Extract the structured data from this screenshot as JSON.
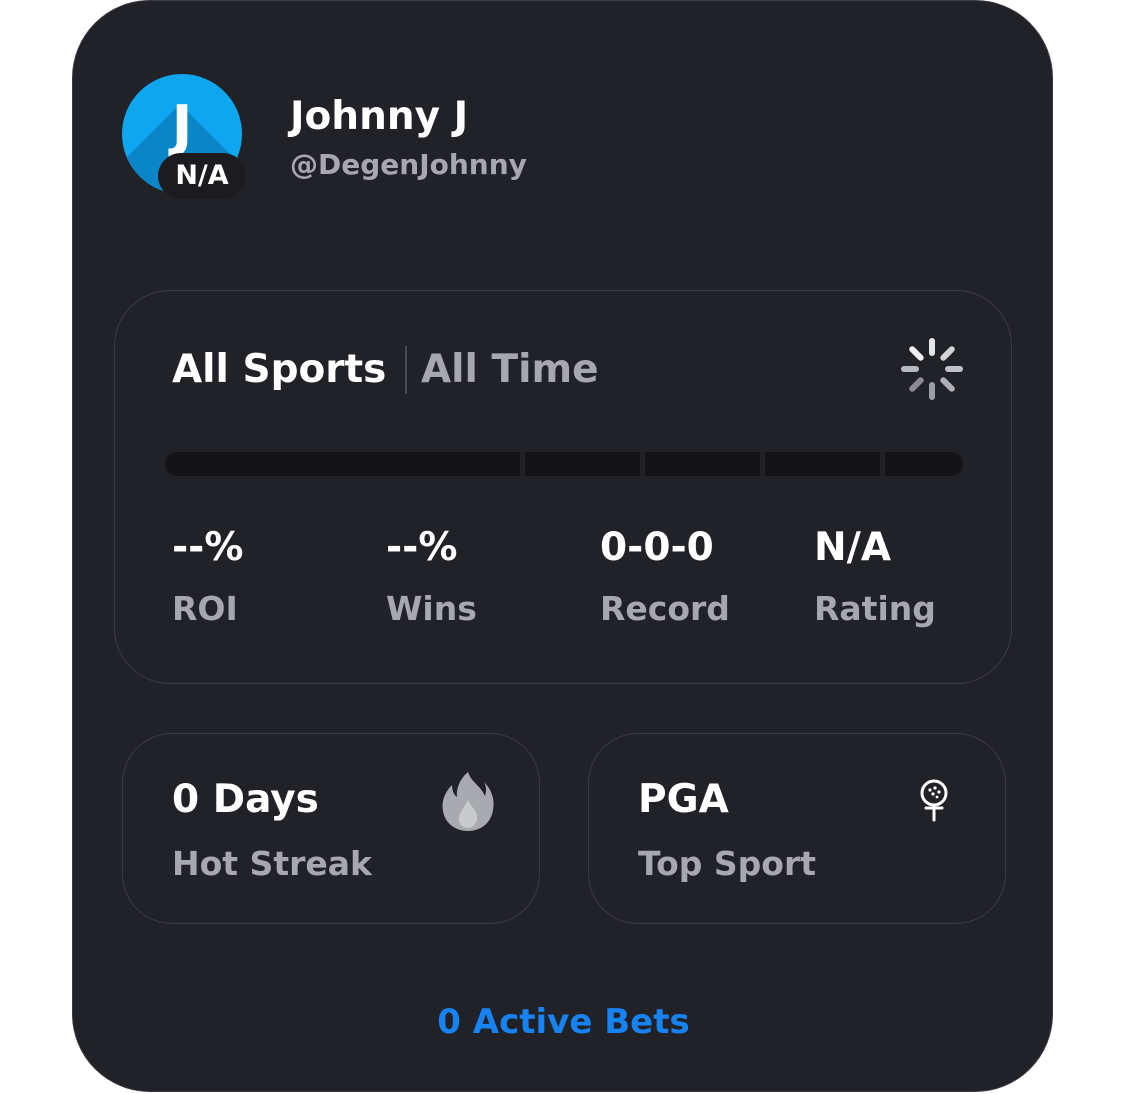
{
  "profile": {
    "avatar_letter": "J",
    "avatar_color": "#0ea6ee",
    "rating_badge": "N/A",
    "name": "Johnny J",
    "handle": "@DegenJohnny"
  },
  "filters": {
    "sport": "All Sports",
    "time": "All Time",
    "loading_icon": "spinner-icon"
  },
  "progress": {
    "segments": 5,
    "filled_fraction": 0
  },
  "stats": [
    {
      "value": "--%",
      "label": "ROI"
    },
    {
      "value": "--%",
      "label": "Wins"
    },
    {
      "value": "0-0-0",
      "label": "Record"
    },
    {
      "value": "N/A",
      "label": "Rating"
    }
  ],
  "streak": {
    "value": "0 Days",
    "label": "Hot Streak",
    "icon": "flame-icon"
  },
  "top_sport": {
    "value": "PGA",
    "label": "Top Sport",
    "icon": "golf-ball-icon"
  },
  "active_bets": {
    "label": "0 Active Bets",
    "color": "#1782f2"
  }
}
